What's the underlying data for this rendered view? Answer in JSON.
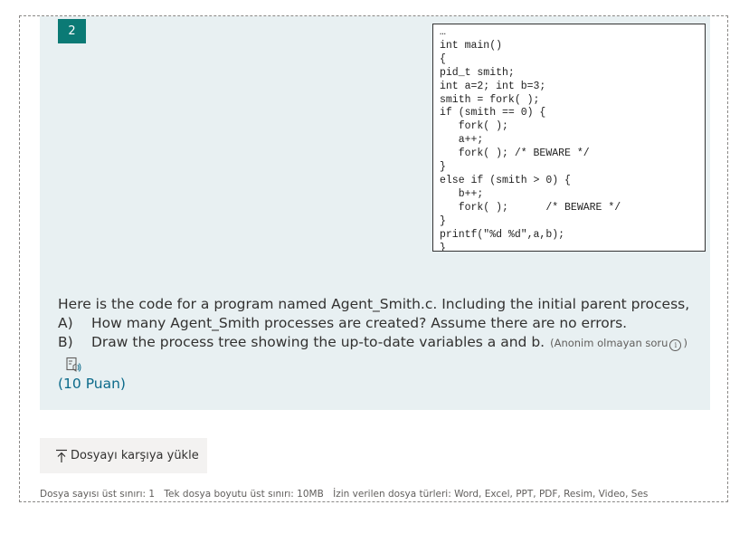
{
  "question": {
    "number": "2",
    "code_lines": [
      "…",
      "int main()",
      "{",
      "pid_t smith;",
      "int a=2; int b=3;",
      "smith = fork( );",
      "if (smith == 0) {",
      "   fork( );",
      "   a++;",
      "   fork( ); /* BEWARE */",
      "}",
      "else if (smith > 0) {",
      "   b++;",
      "   fork( );      /* BEWARE */",
      "}",
      "printf(\"%d %d\",a,b);",
      "}"
    ],
    "text_intro": "Here is the code for a program named Agent_Smith.c. Including the initial parent process,",
    "part_a_prefix": "A)",
    "part_a_text": "How many Agent_Smith processes are created? Assume there are no errors.",
    "part_b_prefix": "B)",
    "part_b_text": "Draw the process tree showing the up-to-date variables a and b.",
    "hint_before": "(Anonim olmayan soru",
    "hint_icon": "i",
    "hint_after": ")",
    "points": "(10 Puan)",
    "immersive_reader_icon": "immersive-reader-icon"
  },
  "upload": {
    "button_label": "Dosyayı karşıya yükle",
    "icon": "upload-arrow-icon"
  },
  "footer": {
    "max_files": "Dosya sayısı üst sınırı: 1",
    "max_size": "Tek dosya boyutu üst sınırı: 10MB",
    "allowed_types": "İzin verilen dosya türleri: Word, Excel, PPT, PDF, Resim, Video, Ses"
  },
  "colors": {
    "accent": "#0b7a75",
    "panel_bg": "#e8f0f2",
    "points_text": "#0b6a8a"
  }
}
